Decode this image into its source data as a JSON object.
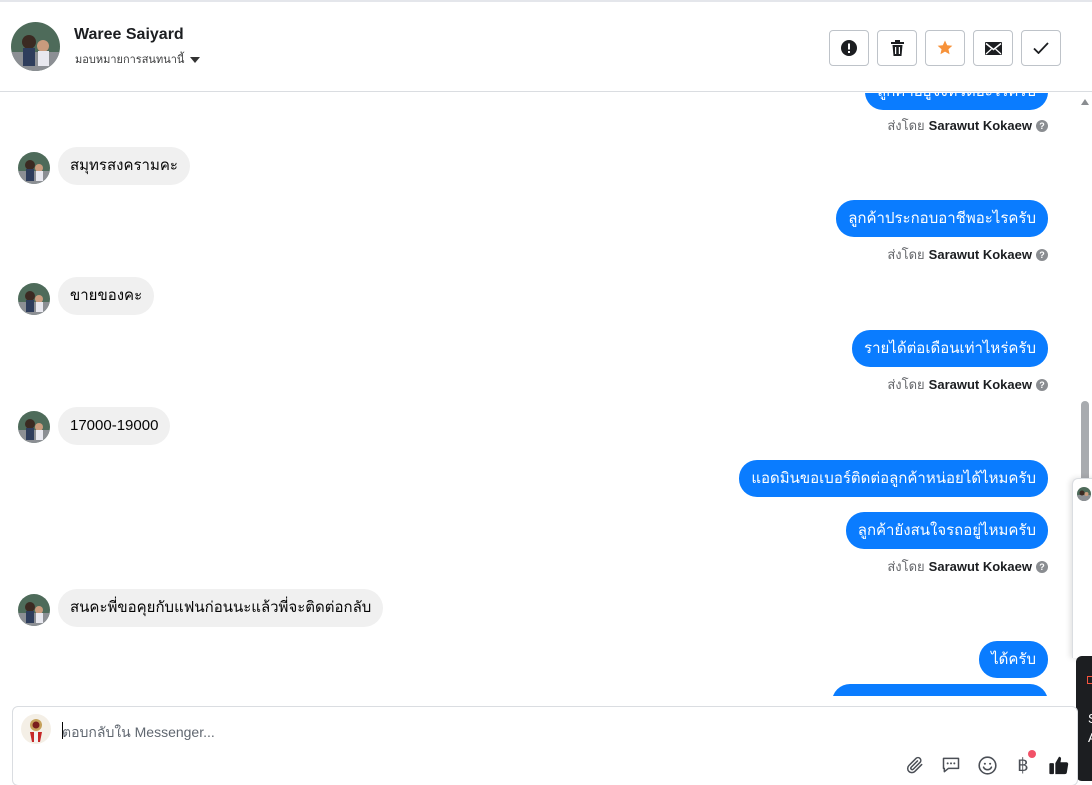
{
  "header": {
    "name": "Waree Saiyard",
    "subtitle": "มอบหมายการสนทนานี้",
    "actions": [
      "exclamation-icon",
      "trash-icon",
      "star-icon",
      "envelope-icon",
      "check-icon"
    ],
    "accent_star": "#f7923a"
  },
  "messages": {
    "sender_prefix": "ส่งโดย",
    "sender_name": "Sarawut Kokaew",
    "help_mark": "?",
    "cut_top_out": "ลูกค้าอยู่จังหวัดอะไรครับ",
    "in_1": "สมุทรสงครามคะ",
    "out_1": "ลูกค้าประกอบอาชีพอะไรครับ",
    "in_2": "ขายของคะ",
    "out_2": "รายได้ต่อเดือนเท่าไหร่ครับ",
    "in_3": "17000-19000",
    "out_3a": "แอดมินขอเบอร์ติดต่อลูกค้าหน่อยได้ไหมครับ",
    "out_3b": "ลูกค้ายังสนใจรถอยู่ไหมครับ",
    "in_4": "สนคะพี่ขอคุยกับแฟนก่อนนะแล้วพี่จะติดต่อกลับ",
    "out_4": "ได้ครับ"
  },
  "side": {
    "line1": "S",
    "line2": "A"
  },
  "composer": {
    "placeholder": "ตอบกลับใน Messenger...",
    "tools": [
      "paperclip-icon",
      "chat-bubble-icon",
      "smiley-icon",
      "baht-icon",
      "thumbs-up-icon"
    ],
    "baht_glyph": "฿"
  },
  "colors": {
    "bubble_out": "#0a7cff",
    "bubble_in": "#f0f0f0",
    "notification_dot": "#f25268"
  }
}
